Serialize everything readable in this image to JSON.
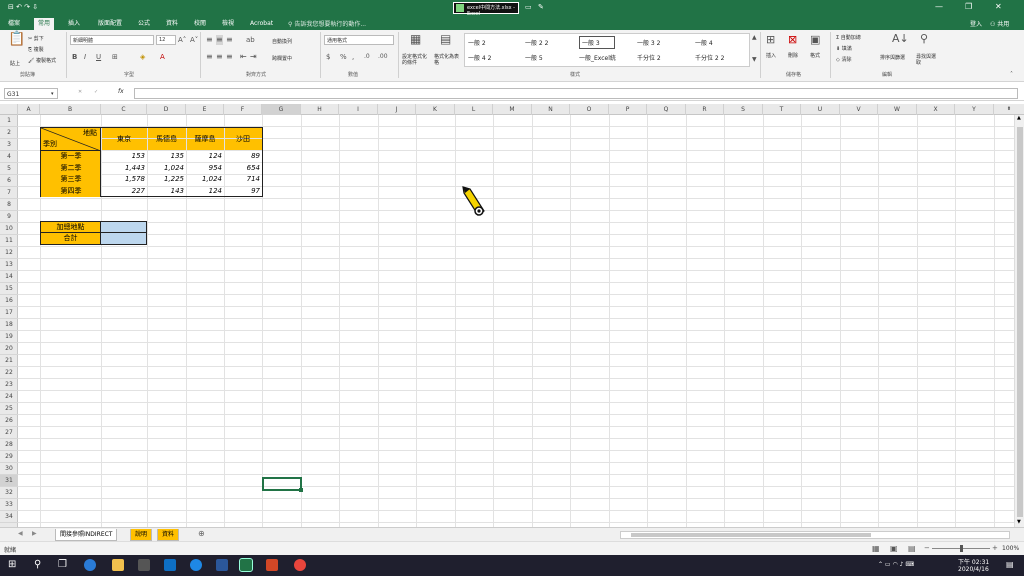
{
  "window": {
    "quick_access": "⊟ ↶ ↷ ⇩",
    "filename": "excel中間方法.xlsx - Excel",
    "search_placeholder": "告訴我您想要執行的動作...",
    "controls": [
      "—",
      "❐",
      "✕"
    ]
  },
  "tabs": [
    "檔案",
    "常用",
    "插入",
    "版面配置",
    "公式",
    "資料",
    "校閱",
    "檢視",
    "Acrobat"
  ],
  "tell_me": "告訴我您想要執行的動作...",
  "account": {
    "signin": "登入",
    "share": "共用"
  },
  "ribbon": {
    "clipboard": {
      "label": "剪貼簿",
      "paste": "貼上",
      "cut": "剪下",
      "copy": "複製",
      "painter": "複製格式"
    },
    "font": {
      "label": "字型",
      "name": "新細明體",
      "size": "12"
    },
    "alignment": {
      "label": "對齊方式",
      "wrap": "自動換列",
      "merge": "跨欄置中"
    },
    "number": {
      "label": "數值",
      "format": "通用格式"
    },
    "styles": {
      "label": "樣式",
      "cond": "設定格式化的條件",
      "table": "格式化為表格",
      "cells": [
        "一般 2",
        "一般 2 2",
        "一般 3",
        "一般 3 2",
        "一般 4",
        "一般 4 2",
        "一般 5",
        "一般_Excel統",
        "千分位 2",
        "千分位 2 2"
      ]
    },
    "cells": {
      "label": "儲存格",
      "insert": "插入",
      "delete": "刪除",
      "format": "格式"
    },
    "editing": {
      "label": "編輯",
      "autosum": "自動加總",
      "fill": "填滿",
      "clear": "清除",
      "sort": "排序與篩選",
      "find": "尋找與選取"
    }
  },
  "formula_bar": {
    "name_box": "G31",
    "fx": "fx",
    "value": ""
  },
  "columns": [
    "A",
    "B",
    "C",
    "D",
    "E",
    "F",
    "G",
    "H",
    "I",
    "J",
    "K",
    "L",
    "M",
    "N",
    "O",
    "P",
    "Q",
    "R",
    "S",
    "T",
    "U",
    "V",
    "W",
    "X",
    "Y"
  ],
  "rows": [
    "1",
    "2",
    "3",
    "4",
    "5",
    "6",
    "7",
    "8",
    "9",
    "10",
    "11",
    "12",
    "13",
    "14",
    "15",
    "16",
    "17",
    "18",
    "19",
    "20",
    "21",
    "22",
    "23",
    "24",
    "25",
    "26",
    "27",
    "28",
    "29",
    "30",
    "31",
    "32",
    "33",
    "34"
  ],
  "table": {
    "corner_top": "地點",
    "corner_bottom": "季別",
    "headers": [
      "東京",
      "馬德島",
      "薩摩島",
      "沙田"
    ],
    "rows": [
      {
        "label": "第一季",
        "values": [
          "153",
          "135",
          "124",
          "89"
        ]
      },
      {
        "label": "第二季",
        "values": [
          "1,443",
          "1,024",
          "954",
          "654"
        ]
      },
      {
        "label": "第三季",
        "values": [
          "1,578",
          "1,225",
          "1,024",
          "714"
        ]
      },
      {
        "label": "第四季",
        "values": [
          "227",
          "143",
          "124",
          "97"
        ]
      }
    ]
  },
  "lookup": {
    "label1": "加總地點",
    "label2": "合計",
    "value1": "",
    "value2": ""
  },
  "sheet_tabs": [
    "間接參照INDIRECT",
    "說明",
    "資料"
  ],
  "status": {
    "mode": "就緒",
    "zoom": "100%"
  },
  "clock": {
    "time": "下午 02:31",
    "date": "2020/4/16"
  },
  "colors": {
    "excel_green": "#217346",
    "accent_yellow": "#ffc000",
    "input_blue": "#bdd7ee"
  }
}
